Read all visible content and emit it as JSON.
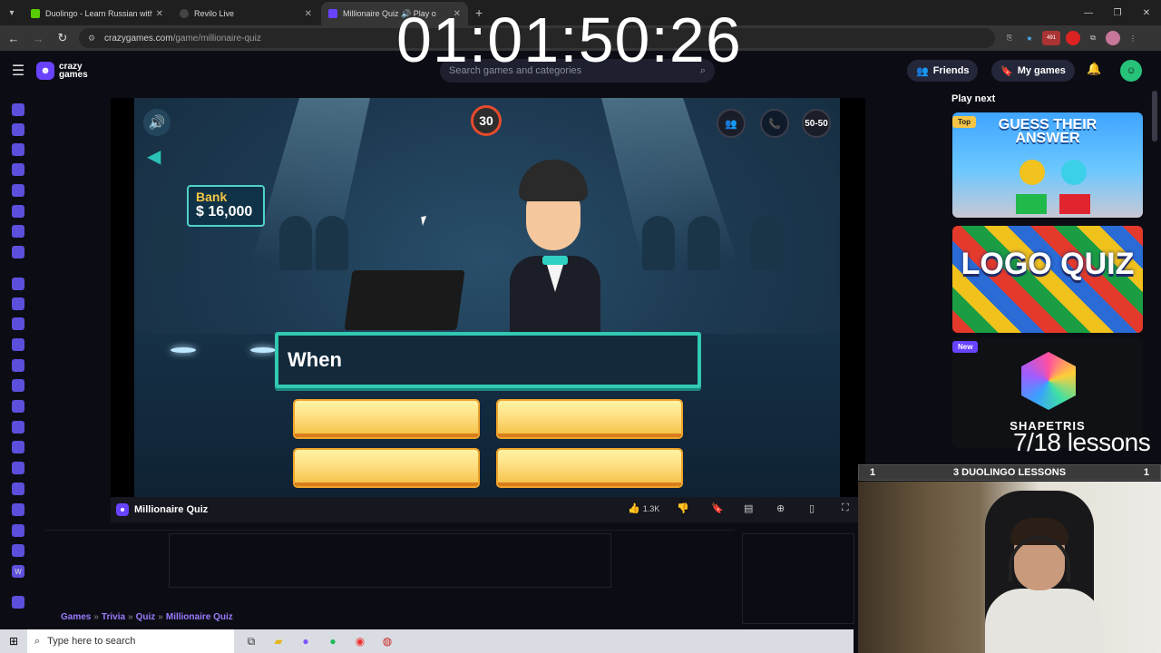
{
  "browser": {
    "tabs": [
      {
        "title": "Duolingo - Learn Russian with l",
        "favicon_color": "#58cc02",
        "active": false
      },
      {
        "title": "Revilo Live",
        "favicon_color": "#444444",
        "active": false
      },
      {
        "title": "Millionaire Quiz 🔊 Play o",
        "favicon_color": "#6842ff",
        "active": true
      }
    ],
    "new_tab": "+",
    "url_host": "crazygames.com",
    "url_path": "/game/millionaire-quiz",
    "extension_badge": "491"
  },
  "overlay": {
    "timer": "01:01:50:26",
    "lesson_count": "7/18 lessons",
    "lesson_bar": {
      "left": "1",
      "title": "3 DUOLINGO LESSONS",
      "right": "1"
    }
  },
  "site": {
    "logo_line1": "crazy",
    "logo_line2": "games",
    "search_placeholder": "Search games and categories",
    "friends_label": "Friends",
    "mygames_label": "My games"
  },
  "game": {
    "timer": "30",
    "bank_label": "Bank",
    "bank_value": "$ 16,000",
    "lifeline_5050": "50-50",
    "question_text": "When",
    "answers": [
      "",
      "",
      "",
      ""
    ]
  },
  "gamebar": {
    "title": "Millionaire Quiz",
    "likes": "1.3K"
  },
  "breadcrumbs": [
    "Games",
    "Trivia",
    "Quiz",
    "Millionaire Quiz"
  ],
  "play_next": {
    "heading": "Play next",
    "items": [
      {
        "title_line1": "GUESS THEIR",
        "title_line2": "ANSWER",
        "badge": "Top"
      },
      {
        "title_line1": "LOGO",
        "title_line2": "QUIZ",
        "badge": ""
      },
      {
        "title_line1": "SHAPETRIS",
        "title_line2": "",
        "badge": "New"
      }
    ]
  },
  "taskbar": {
    "search_placeholder": "Type here to search"
  },
  "colors": {
    "brand": "#6842ff",
    "accent_teal": "#31c9b3",
    "answer_gold": "#f6c44c",
    "timer_ring": "#e64a2e"
  }
}
